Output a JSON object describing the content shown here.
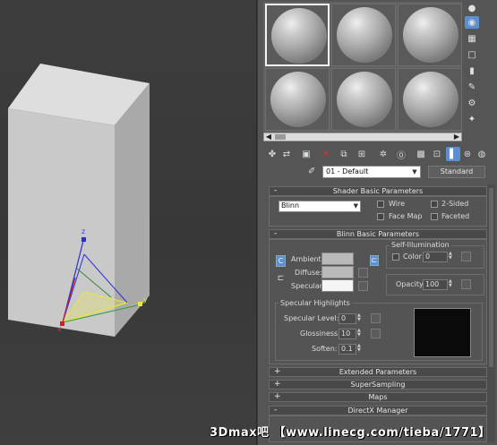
{
  "editor": {
    "material_name": "01 - Default",
    "material_type": "Standard"
  },
  "shader_basic": {
    "title": "Shader Basic Parameters",
    "shader": "Blinn",
    "wire": "Wire",
    "two_sided": "2-Sided",
    "face_map": "Face Map",
    "faceted": "Faceted"
  },
  "blinn_basic": {
    "title": "Blinn Basic Parameters",
    "self_illum_title": "Self-Illumination",
    "color_label": "Color",
    "color_value": "0",
    "ambient": "Ambient:",
    "diffuse": "Diffuse:",
    "specular": "Specular:",
    "lock_c": "C",
    "opacity_label": "Opacity:",
    "opacity_value": "100"
  },
  "spec_highlights": {
    "title": "Specular Highlights",
    "level_label": "Specular Level:",
    "level_value": "0",
    "gloss_label": "Glossiness:",
    "gloss_value": "10",
    "soften_label": "Soften:",
    "soften_value": "0.1"
  },
  "rollouts": {
    "extended": "Extended Parameters",
    "supersampling": "SuperSampling",
    "maps": "Maps",
    "directx": "DirectX Manager"
  },
  "viewport": {
    "axis_x": "x",
    "axis_y": "y",
    "axis_z": "z"
  },
  "watermark": "3Dmax吧 【www.linecg.com/tieba/1771】",
  "colors": {
    "box_front": "#c9c9c9",
    "box_top": "#dedede",
    "box_side": "#a9a9a9",
    "selected_tool": "#5b8fd0"
  }
}
